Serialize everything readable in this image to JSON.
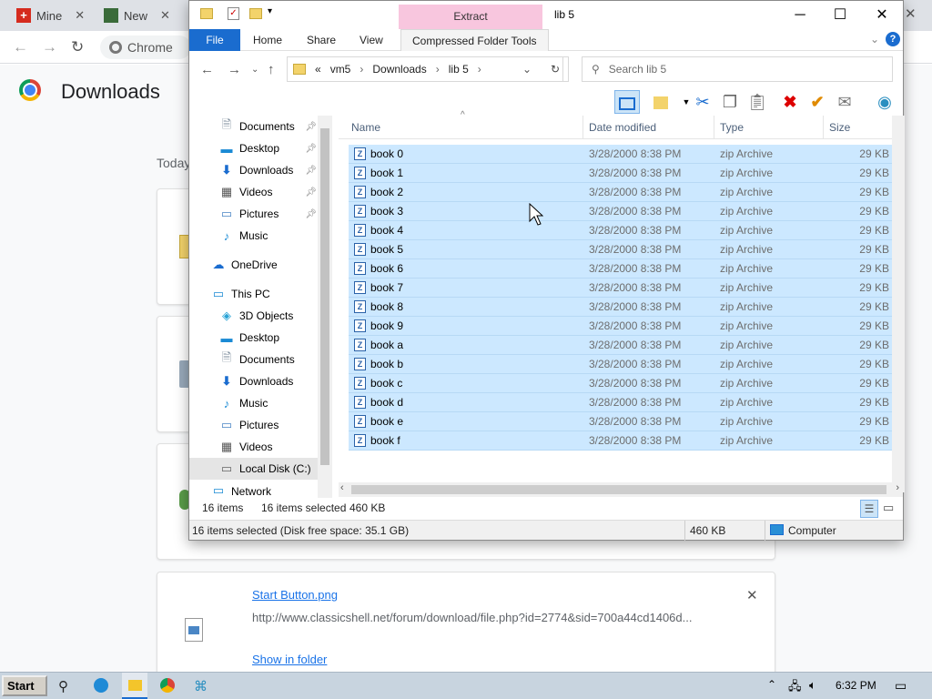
{
  "chrome": {
    "tabs": [
      {
        "label": "Mine"
      },
      {
        "label": "New"
      }
    ],
    "omnibox_text": "Chrome",
    "page_title": "Downloads",
    "section": "Today",
    "download": {
      "filename": "Start Button.png",
      "url": "http://www.classicshell.net/forum/download/file.php?id=2774&sid=700a44cd1406d...",
      "show_in_folder": "Show in folder"
    }
  },
  "explorer": {
    "context_tab": "Extract",
    "title": "lib 5",
    "ribbon": {
      "file": "File",
      "home": "Home",
      "share": "Share",
      "view": "View",
      "tools": "Compressed Folder Tools"
    },
    "address": {
      "prefix": "«",
      "crumbs": [
        "vm5",
        "Downloads",
        "lib 5"
      ]
    },
    "search_placeholder": "Search lib 5",
    "nav": {
      "quick": [
        {
          "label": "Documents"
        },
        {
          "label": "Desktop"
        },
        {
          "label": "Downloads"
        },
        {
          "label": "Videos"
        },
        {
          "label": "Pictures"
        },
        {
          "label": "Music"
        }
      ],
      "onedrive": "OneDrive",
      "thispc": "This PC",
      "pc": [
        {
          "label": "3D Objects"
        },
        {
          "label": "Desktop"
        },
        {
          "label": "Documents"
        },
        {
          "label": "Downloads"
        },
        {
          "label": "Music"
        },
        {
          "label": "Pictures"
        },
        {
          "label": "Videos"
        },
        {
          "label": "Local Disk (C:)"
        }
      ],
      "network": "Network"
    },
    "columns": {
      "name": "Name",
      "date": "Date modified",
      "type": "Type",
      "size": "Size"
    },
    "files": [
      {
        "name": "book 0",
        "date": "3/28/2000 8:38 PM",
        "type": "zip Archive",
        "size": "29 KB"
      },
      {
        "name": "book 1",
        "date": "3/28/2000 8:38 PM",
        "type": "zip Archive",
        "size": "29 KB"
      },
      {
        "name": "book 2",
        "date": "3/28/2000 8:38 PM",
        "type": "zip Archive",
        "size": "29 KB"
      },
      {
        "name": "book 3",
        "date": "3/28/2000 8:38 PM",
        "type": "zip Archive",
        "size": "29 KB"
      },
      {
        "name": "book 4",
        "date": "3/28/2000 8:38 PM",
        "type": "zip Archive",
        "size": "29 KB"
      },
      {
        "name": "book 5",
        "date": "3/28/2000 8:38 PM",
        "type": "zip Archive",
        "size": "29 KB"
      },
      {
        "name": "book 6",
        "date": "3/28/2000 8:38 PM",
        "type": "zip Archive",
        "size": "29 KB"
      },
      {
        "name": "book 7",
        "date": "3/28/2000 8:38 PM",
        "type": "zip Archive",
        "size": "29 KB"
      },
      {
        "name": "book 8",
        "date": "3/28/2000 8:38 PM",
        "type": "zip Archive",
        "size": "29 KB"
      },
      {
        "name": "book 9",
        "date": "3/28/2000 8:38 PM",
        "type": "zip Archive",
        "size": "29 KB"
      },
      {
        "name": "book a",
        "date": "3/28/2000 8:38 PM",
        "type": "zip Archive",
        "size": "29 KB"
      },
      {
        "name": "book b",
        "date": "3/28/2000 8:38 PM",
        "type": "zip Archive",
        "size": "29 KB"
      },
      {
        "name": "book c",
        "date": "3/28/2000 8:38 PM",
        "type": "zip Archive",
        "size": "29 KB"
      },
      {
        "name": "book d",
        "date": "3/28/2000 8:38 PM",
        "type": "zip Archive",
        "size": "29 KB"
      },
      {
        "name": "book e",
        "date": "3/28/2000 8:38 PM",
        "type": "zip Archive",
        "size": "29 KB"
      },
      {
        "name": "book f",
        "date": "3/28/2000 8:38 PM",
        "type": "zip Archive",
        "size": "29 KB"
      }
    ],
    "status": {
      "count": "16 items",
      "selected": "16 items selected",
      "size": "460 KB",
      "bar_text": "16 items selected (Disk free space: 35.1 GB)",
      "bar_size": "460 KB",
      "bar_location": "Computer"
    }
  },
  "taskbar": {
    "start": "Start",
    "time": "6:32 PM"
  },
  "colors": {
    "selection": "#cce8ff",
    "file_tab": "#1a6ccf",
    "context_tab": "#f8c6de"
  }
}
